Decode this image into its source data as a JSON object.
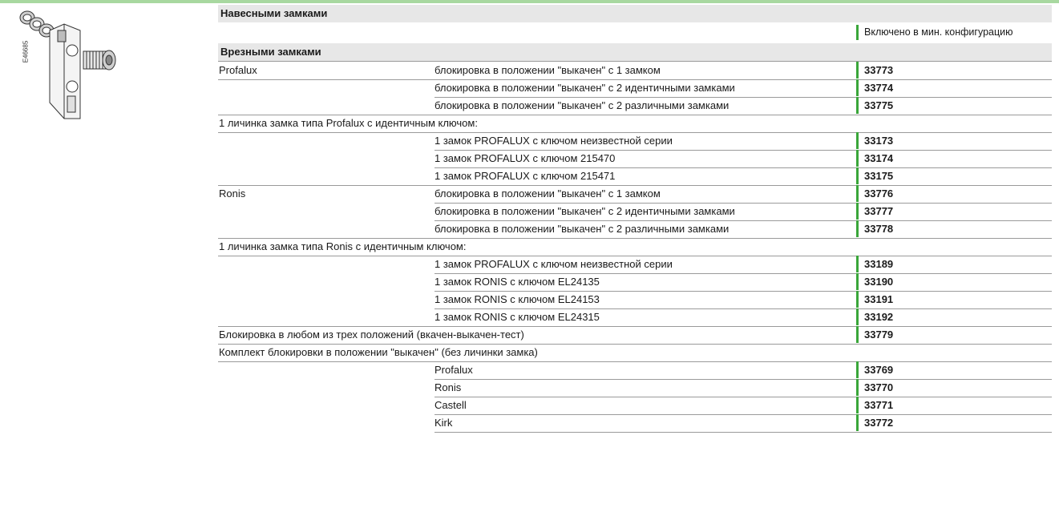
{
  "figure_code": "E46685",
  "header_padlocks": "Навесными замками",
  "included_note": "Включено в мин. конфигурацию",
  "header_keylocks": "Врезными замками",
  "rows": [
    {
      "c1": "Profalux",
      "c2": "блокировка в положении \"выкачен\"  с 1 замком",
      "c3": "33773",
      "line": "full"
    },
    {
      "c1": "",
      "c2": "блокировка в положении \"выкачен\"  с  2 идентичными замками",
      "c3": "33774",
      "line": "partial"
    },
    {
      "c1": "",
      "c2": "блокировка в положении \"выкачен\"  с 2 различными замками",
      "c3": "33775",
      "line": "full"
    },
    {
      "c1": "1 личинка замка типа Profalux с идентичным ключом:",
      "c2": "",
      "c3": "",
      "line": "full"
    },
    {
      "c1": "",
      "c2": "1 замок PROFALUX с ключом неизвестной серии",
      "c3": "33173",
      "line": "partial"
    },
    {
      "c1": "",
      "c2": "1 замок PROFALUX с ключом 215470",
      "c3": "33174",
      "line": "partial"
    },
    {
      "c1": "",
      "c2": "1 замок PROFALUX с ключом 215471",
      "c3": "33175",
      "line": "full"
    },
    {
      "c1": "Ronis",
      "c2": "блокировка в положении \"выкачен\"  с 1 замком",
      "c3": "33776",
      "line": "partial"
    },
    {
      "c1": "",
      "c2": "блокировка в положении \"выкачен\"  с  2 идентичными замками",
      "c3": "33777",
      "line": "partial"
    },
    {
      "c1": "",
      "c2": "блокировка в положении \"выкачен\"  с 2 различными замками",
      "c3": "33778",
      "line": "full"
    },
    {
      "c1": "1 личинка замка типа Ronis с идентичным ключом:",
      "c2": "",
      "c3": "",
      "line": "full"
    },
    {
      "c1": "",
      "c2": "1 замок PROFALUX с ключом неизвестной серии",
      "c3": "33189",
      "line": "partial"
    },
    {
      "c1": "",
      "c2": "1 замок RONIS с ключом EL24135",
      "c3": "33190",
      "line": "partial"
    },
    {
      "c1": "",
      "c2": "1 замок RONIS с ключом EL24153",
      "c3": "33191",
      "line": "partial"
    },
    {
      "c1": "",
      "c2": "1 замок RONIS с ключом EL24315",
      "c3": "33192",
      "line": "full"
    },
    {
      "c1": "Блокировка в любом из трех положений (вкачен-выкачен-тест)",
      "c2": "",
      "c3": "33779",
      "line": "full"
    },
    {
      "c1": "Комплект блокировки  в положении \"выкачен\" (без личинки замка)",
      "c2": "",
      "c3": "",
      "line": "full"
    },
    {
      "c1": "",
      "c2": "Profalux",
      "c3": "33769",
      "line": "partial"
    },
    {
      "c1": "",
      "c2": "Ronis",
      "c3": "33770",
      "line": "partial"
    },
    {
      "c1": "",
      "c2": "Castell",
      "c3": "33771",
      "line": "partial"
    },
    {
      "c1": "",
      "c2": "Kirk",
      "c3": "33772",
      "line": "partial"
    }
  ]
}
